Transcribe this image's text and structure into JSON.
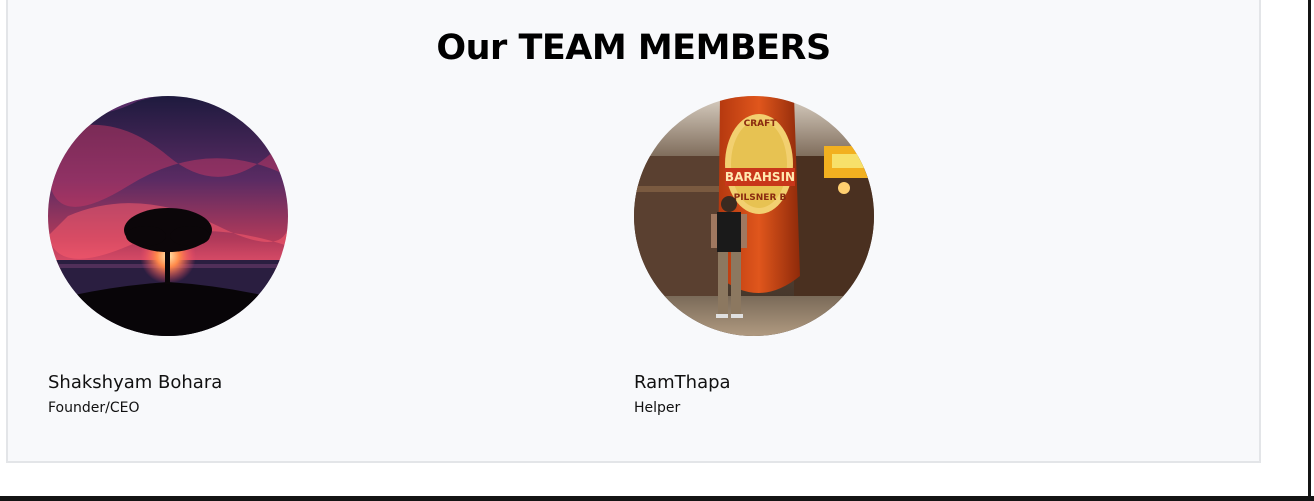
{
  "section": {
    "title": "Our TEAM MEMBERS"
  },
  "members": [
    {
      "name": "Shakshyam Bohara",
      "role": "Founder/CEO",
      "photo": "sunset-tree-photo"
    },
    {
      "name": "RamThapa",
      "role": "Helper",
      "photo": "person-with-beer-bottle-photo"
    }
  ],
  "photo_text": {
    "label_top": "CRAFT",
    "label_brand": "BARAHSIN",
    "label_sub": "PILSNER B"
  },
  "colors": {
    "card_bg": "#f8f9fb",
    "card_border": "#e3e5e8",
    "text": "#111111"
  }
}
